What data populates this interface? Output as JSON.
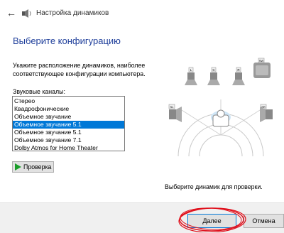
{
  "window": {
    "title": "Настройка динамиков",
    "back_icon": "back-arrow-icon",
    "app_icon": "speaker-icon"
  },
  "main": {
    "heading": "Выберите конфигурацию",
    "description": "Укажите расположение динамиков, наиболее соответствующее конфигурации компьютера.",
    "channels_label": "Звуковые каналы:",
    "channels": [
      "Стерео",
      "Квадрофонические",
      "Объемное звучание",
      "Объемное звучание 5.1",
      "Объемное звучание 5.1",
      "Объемное звучание 7.1",
      "Dolby Atmos for Home Theater"
    ],
    "selected_channel": "Объемное звучание 5.1",
    "test_button": "Проверка",
    "speaker_labels": [
      "L",
      "C",
      "R",
      "SW",
      "SL",
      "SR"
    ],
    "hint": "Выберите динамик для проверки."
  },
  "footer": {
    "next_label": "Далее",
    "cancel_label": "Отмена"
  },
  "colors": {
    "accent": "#0078d7",
    "heading": "#1f3f9b",
    "annotation": "#e0101c"
  }
}
